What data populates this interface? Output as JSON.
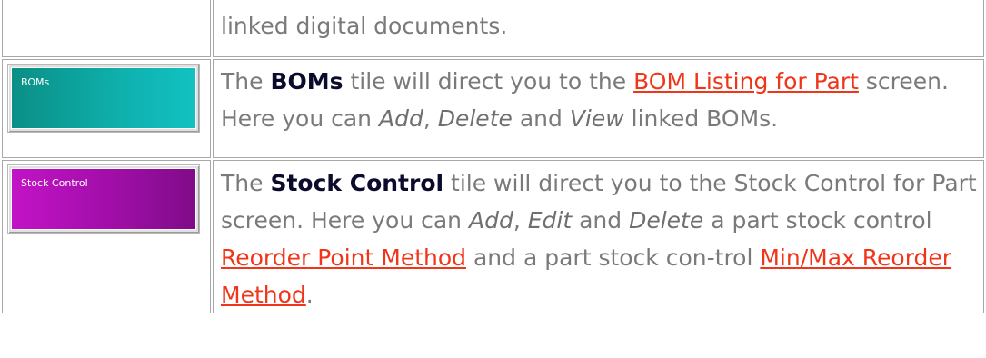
{
  "rows": [
    {
      "text": "linked digital documents."
    },
    {
      "tile_label": "BOMs",
      "tile_color": "#10b3b0",
      "p1": "The ",
      "bold": "BOMs",
      "p2": " tile will direct you to the ",
      "link1": "BOM Listing for Part",
      "p3": " screen. Here you can ",
      "i1": "Add",
      "p4": ", ",
      "i2": "Delete",
      "p5": " and ",
      "i3": "View",
      "p6": " linked BOMs."
    },
    {
      "tile_label": "Stock Control",
      "tile_color": "#a60fb0",
      "p1": "The ",
      "bold": "Stock Control",
      "p2": " tile will direct you to the Stock Control for Part screen. Here you can ",
      "i1": "Add",
      "p3": ", ",
      "i2": "Edit",
      "p4": " and ",
      "i3": "Delete",
      "p5": " a part stock control ",
      "link1": "Reorder Point Method",
      "p6": " and a part stock con-trol ",
      "link2": "Min/Max Reorder Method",
      "p7": "."
    }
  ]
}
